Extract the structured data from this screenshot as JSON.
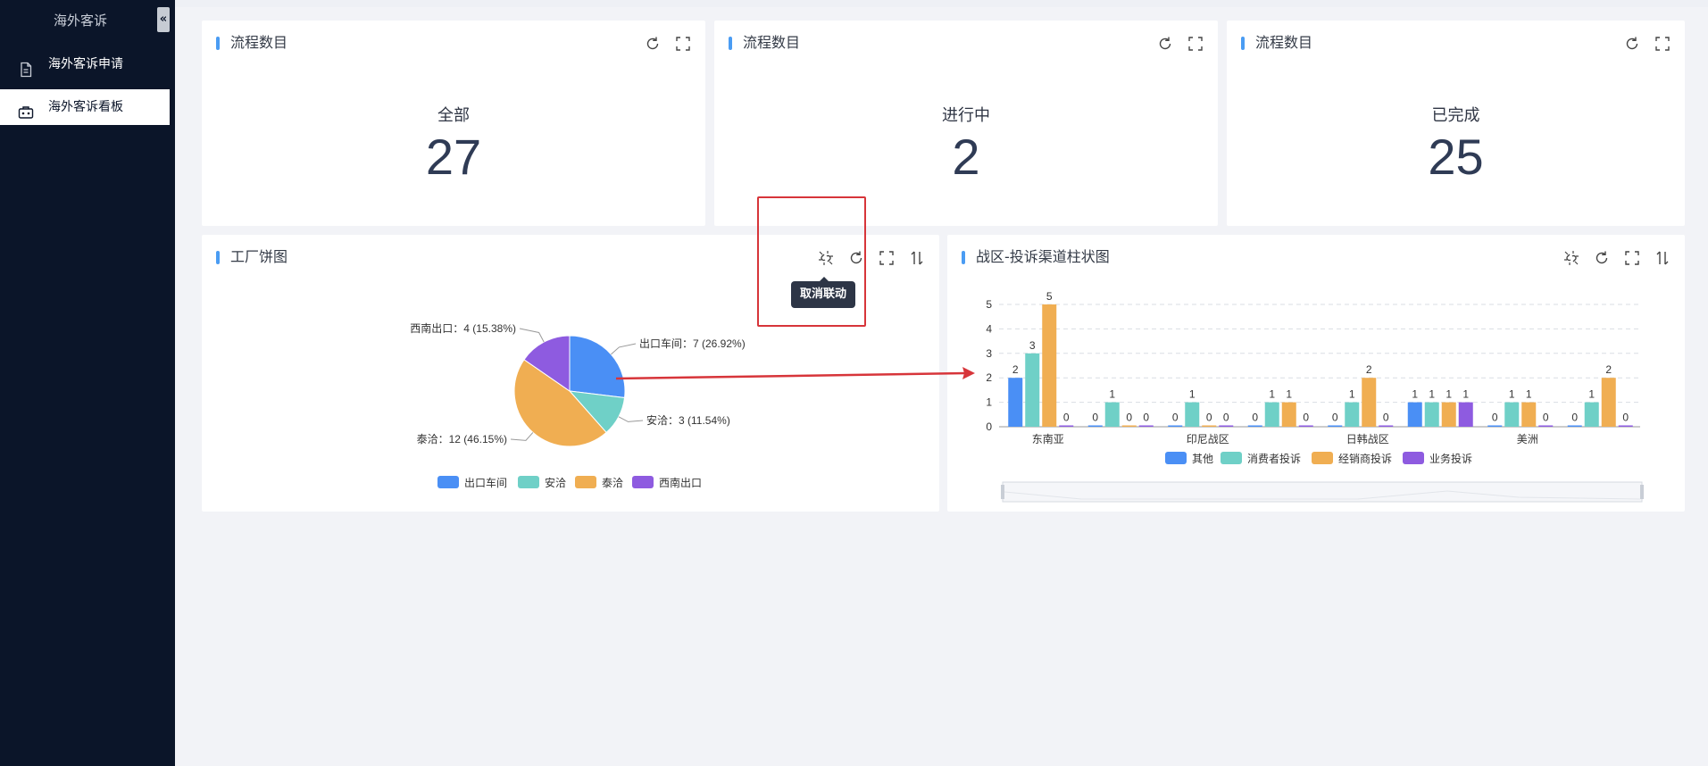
{
  "sidebar": {
    "title": "海外客诉",
    "collapse_label": "«",
    "items": [
      {
        "label": "海外客诉申请",
        "icon": "document-icon",
        "active": false
      },
      {
        "label": "海外客诉看板",
        "icon": "dashboard-icon",
        "active": true
      }
    ]
  },
  "stats": [
    {
      "title": "流程数目",
      "label": "全部",
      "value": "27"
    },
    {
      "title": "流程数目",
      "label": "进行中",
      "value": "2"
    },
    {
      "title": "流程数目",
      "label": "已完成",
      "value": "25"
    }
  ],
  "pie_card": {
    "title": "工厂饼图",
    "tooltip": "取消联动"
  },
  "bar_card": {
    "title": "战区-投诉渠道柱状图"
  },
  "colors": {
    "blue": "#4a8ff5",
    "teal": "#6fd0c7",
    "orange": "#f0ae52",
    "purple": "#8e5be0",
    "accent": "#4a9cf3",
    "sidebar": "#0b1529",
    "annotation_red": "#d7353a"
  },
  "chart_data": [
    {
      "type": "pie",
      "slices": [
        {
          "name": "出口车间",
          "value": 7,
          "percent": "26.92%",
          "label": "出口车间：7 (26.92%)"
        },
        {
          "name": "安洽",
          "value": 3,
          "percent": "11.54%",
          "label": "安洽：3 (11.54%)"
        },
        {
          "name": "泰洽",
          "value": 12,
          "percent": "46.15%",
          "label": "泰洽：12 (46.15%)"
        },
        {
          "name": "西南出口",
          "value": 4,
          "percent": "15.38%",
          "label": "西南出口：4 (15.38%)"
        }
      ],
      "legend": [
        "出口车间",
        "安洽",
        "泰洽",
        "西南出口"
      ],
      "legend_position": "bottom"
    },
    {
      "type": "bar",
      "categories": [
        "东南亚",
        "",
        "印尼战区",
        "",
        "日韩战区",
        "",
        "美洲",
        ""
      ],
      "series": [
        {
          "name": "其他",
          "values": [
            2,
            0,
            0,
            0,
            0,
            1,
            0,
            0
          ]
        },
        {
          "name": "消费者投诉",
          "values": [
            3,
            1,
            1,
            1,
            1,
            1,
            1,
            1
          ]
        },
        {
          "name": "经销商投诉",
          "values": [
            5,
            0,
            0,
            1,
            2,
            1,
            1,
            2
          ]
        },
        {
          "name": "业务投诉",
          "values": [
            0,
            0,
            0,
            0,
            0,
            1,
            0,
            0
          ]
        }
      ],
      "ylim": [
        0,
        5
      ],
      "yticks": [
        "0",
        "1",
        "2",
        "3",
        "4",
        "5"
      ],
      "grid": true,
      "legend_position": "bottom"
    }
  ]
}
